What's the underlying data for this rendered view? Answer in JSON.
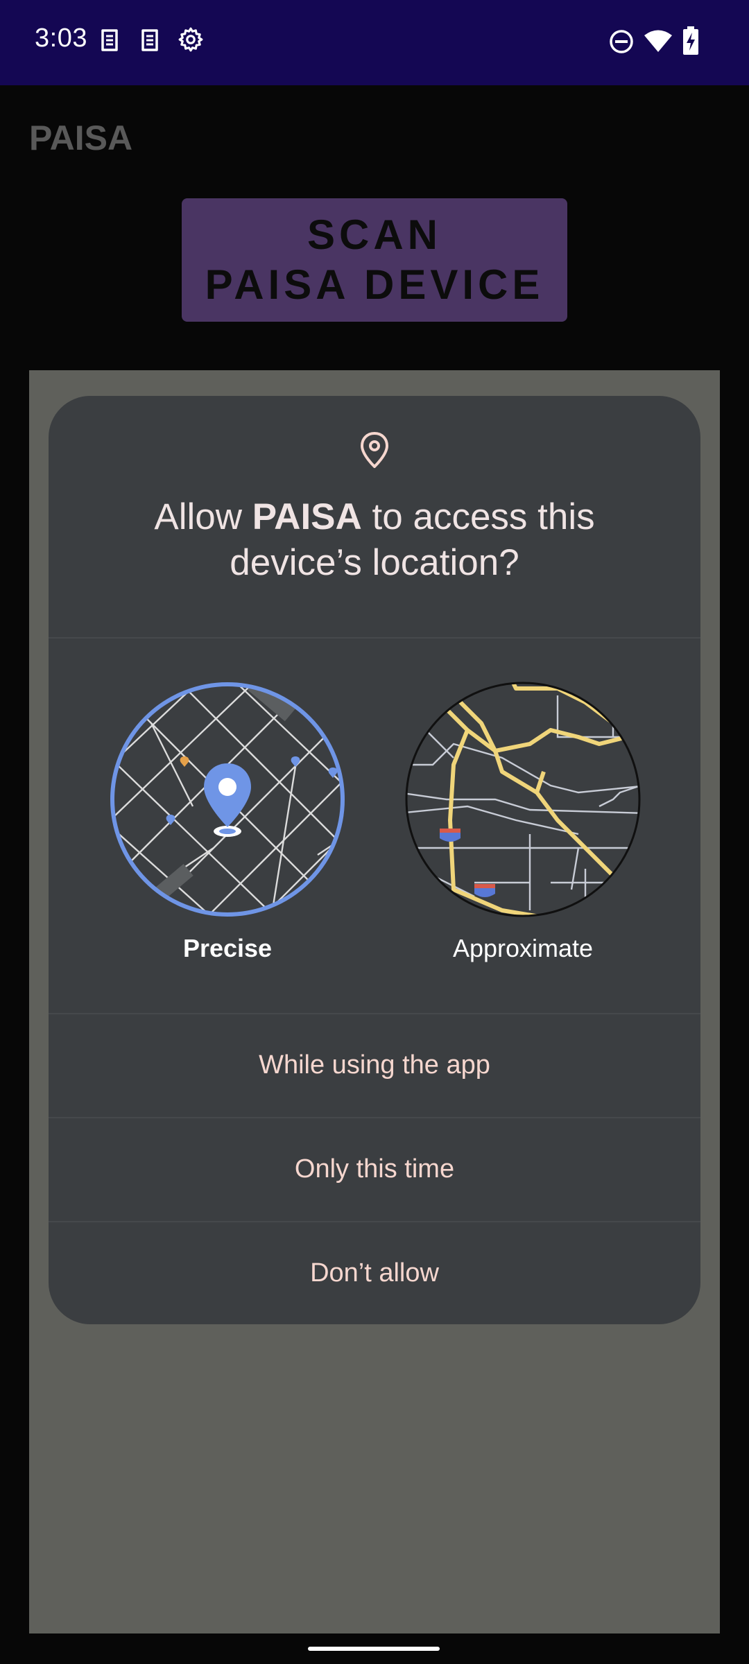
{
  "status_bar": {
    "time": "3:03",
    "left_icons": [
      "sim-card-icon",
      "sim-card-icon",
      "settings-gear-icon"
    ],
    "right_icons": [
      "do-not-disturb-icon",
      "wifi-icon",
      "battery-charging-icon"
    ]
  },
  "app": {
    "title": "PAISA",
    "scan_button_label": "SCAN\nPAISA DEVICE"
  },
  "dialog": {
    "icon": "location-pin-icon",
    "title_prefix": "Allow ",
    "title_app": "PAISA",
    "title_suffix": " to access this device’s location?",
    "options": {
      "precise": {
        "label": "Precise",
        "icon": "precise-map-icon",
        "selected": true
      },
      "approximate": {
        "label": "Approximate",
        "icon": "approximate-map-icon",
        "selected": false
      }
    },
    "buttons": {
      "while_using": "While using the app",
      "only_this_time": "Only this time",
      "dont_allow": "Don’t allow"
    }
  },
  "colors": {
    "status_bar_bg": "#140753",
    "scan_button_bg": "#4a3563",
    "dialog_bg": "#3b3e41",
    "accent_blue": "#6f95e6",
    "button_text": "#f6d7cf"
  }
}
